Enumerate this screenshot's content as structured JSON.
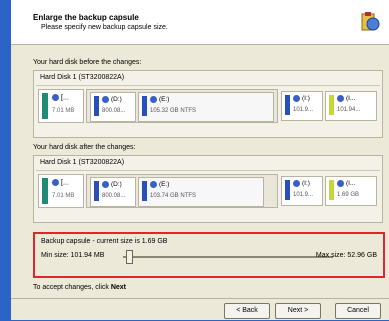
{
  "header": {
    "title": "Enlarge the backup capsule",
    "subtitle": "Please specify new backup capsule size."
  },
  "before": {
    "label": "Your hard disk before the changes:",
    "disk_title": "Hard Disk 1 (ST3200822A)",
    "system": {
      "label": "[...",
      "size": "7.01 MB"
    },
    "partitions": [
      {
        "label": "(D:)",
        "size": "800.08..."
      },
      {
        "label": "(E:)",
        "size": "105.32 GB  NTFS"
      },
      {
        "label": "(I:)",
        "size": "101.9..."
      },
      {
        "label": "(I...",
        "size": "101.94..."
      }
    ]
  },
  "after": {
    "label": "Your hard disk after the changes:",
    "disk_title": "Hard Disk 1 (ST3200822A)",
    "system": {
      "label": "[...",
      "size": "7.01 MB"
    },
    "partitions": [
      {
        "label": "(D:)",
        "size": "800.08..."
      },
      {
        "label": "(E:)",
        "size": "103.74 GB  NTFS"
      },
      {
        "label": "(I:)",
        "size": "101.9..."
      },
      {
        "label": "(I...",
        "size": "1.69 GB"
      }
    ]
  },
  "resize": {
    "title": "Backup capsule - current size is 1.69 GB",
    "min_label": "Min size:  101.94 MB",
    "max_label": "Max size:  52.96 GB",
    "slider_value_fraction": 0.03
  },
  "hint": {
    "text": "To accept changes, click ",
    "bold": "Next"
  },
  "buttons": {
    "back": "< Back",
    "next": "Next >",
    "cancel": "Cancel"
  },
  "colors": {
    "system": "#1f8a78",
    "partition": "#2850b8",
    "capsule": "#c8d43c",
    "highlight": "#e2242f"
  }
}
